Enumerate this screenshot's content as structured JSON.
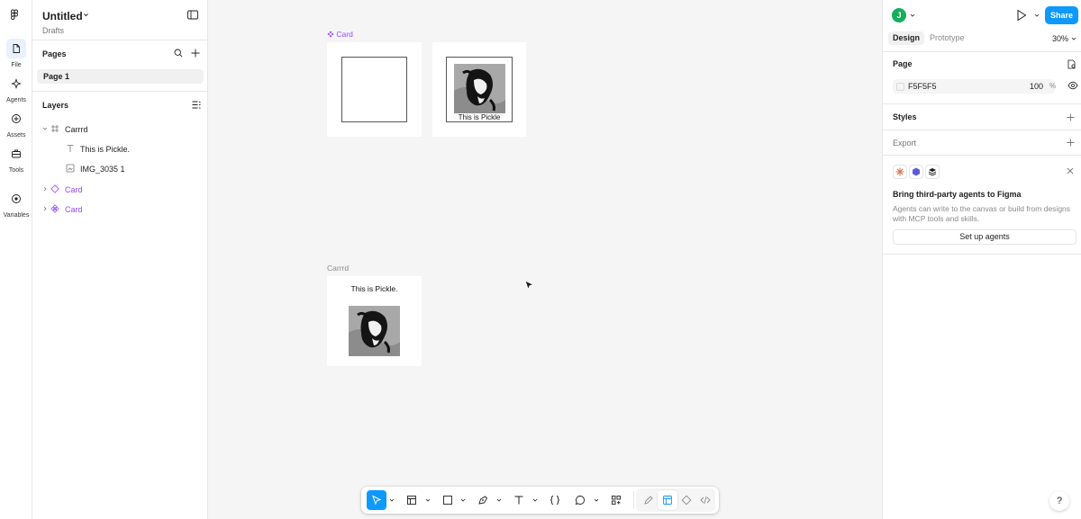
{
  "rail": {
    "items": [
      {
        "label": "File",
        "icon": "file-icon"
      },
      {
        "label": "Agents",
        "icon": "agents-icon"
      },
      {
        "label": "Assets",
        "icon": "assets-icon"
      },
      {
        "label": "Tools",
        "icon": "tools-icon"
      },
      {
        "label": "Variables",
        "icon": "variables-icon"
      }
    ]
  },
  "file": {
    "title": "Untitled",
    "location": "Drafts"
  },
  "pages": {
    "heading": "Pages",
    "items": [
      "Page 1"
    ]
  },
  "layers": {
    "heading": "Layers",
    "items": [
      {
        "label": "Carrrd",
        "type": "frame-icon"
      },
      {
        "label": "This is Pickle.",
        "type": "text-icon"
      },
      {
        "label": "IMG_3035 1",
        "type": "image-icon"
      },
      {
        "label": "Card",
        "type": "component-set-icon"
      },
      {
        "label": "Card",
        "type": "component-icon"
      }
    ]
  },
  "canvas": {
    "component_label": "Card",
    "frame_label": "Carrrd",
    "variant_caption": "This is Pickle",
    "frame_caption": "This is Pickle."
  },
  "toolbar": {
    "tools": [
      "move-tool",
      "frame-tool",
      "shape-tool",
      "pen-tool",
      "text-tool",
      "code-tool",
      "comment-tool",
      "actions-tool"
    ],
    "modes": [
      "draw-mode",
      "design-mode",
      "dev-component-mode",
      "dev-mode"
    ]
  },
  "right": {
    "user_initial": "J",
    "share_label": "Share",
    "tabs": [
      "Design",
      "Prototype"
    ],
    "zoom": "30%",
    "page_heading": "Page",
    "page_color": "F5F5F5",
    "page_opacity": "100",
    "opacity_unit": "%",
    "styles_heading": "Styles",
    "export_heading": "Export",
    "agents_title": "Bring third-party agents to Figma",
    "agents_desc": "Agents can write to the canvas or build from designs with MCP tools and skills.",
    "setup_label": "Set up agents",
    "help_label": "?"
  },
  "colors": {
    "accent": "#0d99ff",
    "component": "#9747ff",
    "avatar": "#14ae5c",
    "canvas": "#f5f5f5"
  }
}
